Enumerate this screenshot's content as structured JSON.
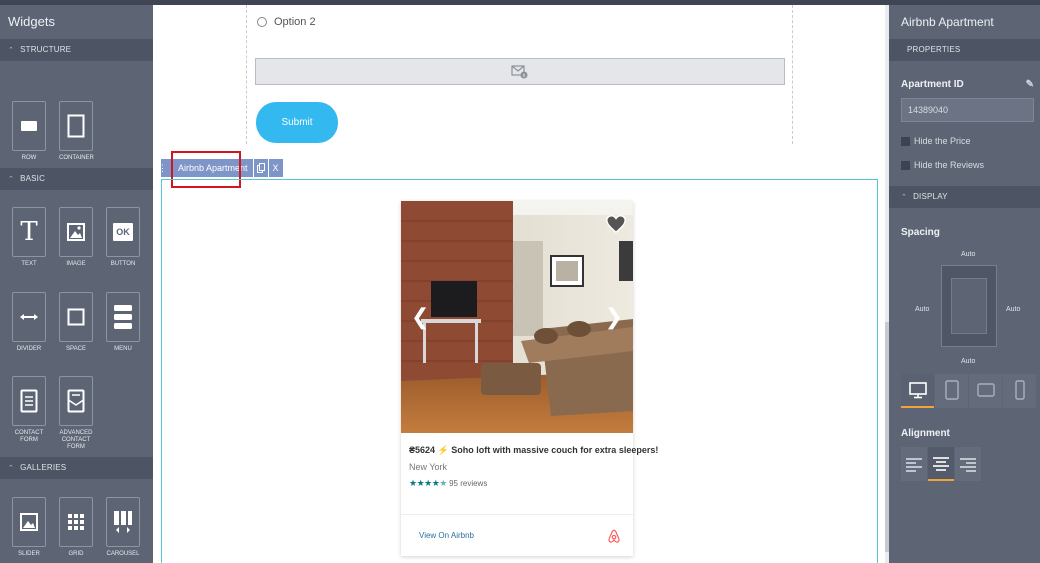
{
  "left_panel": {
    "title": "Widgets",
    "sections": {
      "structure": "STRUCTURE",
      "basic": "BASIC",
      "galleries": "GALLERIES"
    },
    "structure_items": [
      {
        "label": "ROW",
        "icon": "row-icon"
      },
      {
        "label": "CONTAINER",
        "icon": "container-icon"
      }
    ],
    "basic_items": [
      {
        "label": "TEXT",
        "icon": "text-icon"
      },
      {
        "label": "IMAGE",
        "icon": "image-icon"
      },
      {
        "label": "BUTTON",
        "icon": "button-icon",
        "glyph": "OK"
      },
      {
        "label": "DIVIDER",
        "icon": "divider-icon"
      },
      {
        "label": "SPACE",
        "icon": "space-icon"
      },
      {
        "label": "MENU",
        "icon": "menu-icon"
      },
      {
        "label": "CONTACT FORM",
        "icon": "contact-form-icon"
      },
      {
        "label": "ADVANCED CONTACT FORM",
        "icon": "advanced-contact-form-icon"
      }
    ],
    "gallery_items": [
      {
        "label": "SLIDER",
        "icon": "slider-icon"
      },
      {
        "label": "GRID",
        "icon": "grid-icon"
      },
      {
        "label": "CAROUSEL",
        "icon": "carousel-icon"
      }
    ]
  },
  "canvas": {
    "form": {
      "option_label": "Option 2",
      "submit_label": "Submit"
    },
    "selected_widget": {
      "name": "Airbnb Apartment",
      "close_glyph": "X"
    },
    "listing": {
      "price": "₴5624",
      "title": "Soho loft with massive couch for extra sleepers!",
      "city": "New York",
      "stars": "★★★★",
      "reviews": "95 reviews",
      "link": "View On Airbnb"
    }
  },
  "right_panel": {
    "title": "Airbnb Apartment",
    "properties_section": "PROPERTIES",
    "apartment_id_label": "Apartment ID",
    "apartment_id_value": "14389040",
    "hide_price_label": "Hide the Price",
    "hide_reviews_label": "Hide the Reviews",
    "display_section": "DISPLAY",
    "spacing_label": "Spacing",
    "spacing": {
      "top": "Auto",
      "left": "Auto",
      "right": "Auto",
      "bottom": "Auto"
    },
    "alignment_label": "Alignment"
  },
  "colors": {
    "panel_bg": "#5d6575",
    "section_bg": "#4d5463",
    "submit_button": "#33b8f0",
    "selection_outline": "#57c5d8",
    "highlight_red": "#d0161e",
    "star_teal": "#0a7b86",
    "airbnb_red": "#ff5a5f",
    "active_tab": "#f2a23a"
  }
}
